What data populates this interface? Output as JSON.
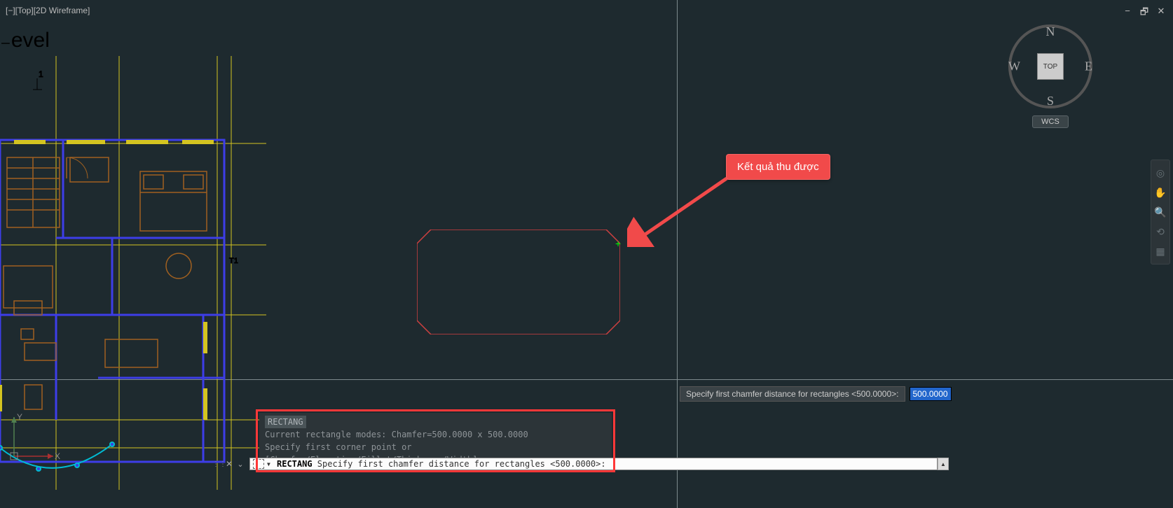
{
  "viewport_label": "[−][Top][2D Wireframe]",
  "level_text": "₋evel",
  "window_controls": {
    "minimize": "−",
    "maximize": "🗗",
    "close": "✕"
  },
  "view_nav": {
    "n": "N",
    "s": "S",
    "e": "E",
    "w": "W",
    "cube": "TOP",
    "wcs": "WCS"
  },
  "annotation": "Kết quả thu được",
  "tooltip": {
    "label": "Specify first chamfer distance for rectangles <500.0000>:",
    "value": "500.0000"
  },
  "cmd_history": {
    "line1_cmd": "RECTANG",
    "line2": "Current rectangle modes:  Chamfer=500.0000 x 500.0000",
    "line3": "Specify first corner point or [Chamfer/Elevation/Fillet/Thickness/Width]: c"
  },
  "cmd_line": {
    "cmd": "RECTANG",
    "prompt": " Specify first chamfer distance for rectangles <500.0000>:"
  },
  "ucs_labels": {
    "x": "X",
    "y": "Y"
  }
}
